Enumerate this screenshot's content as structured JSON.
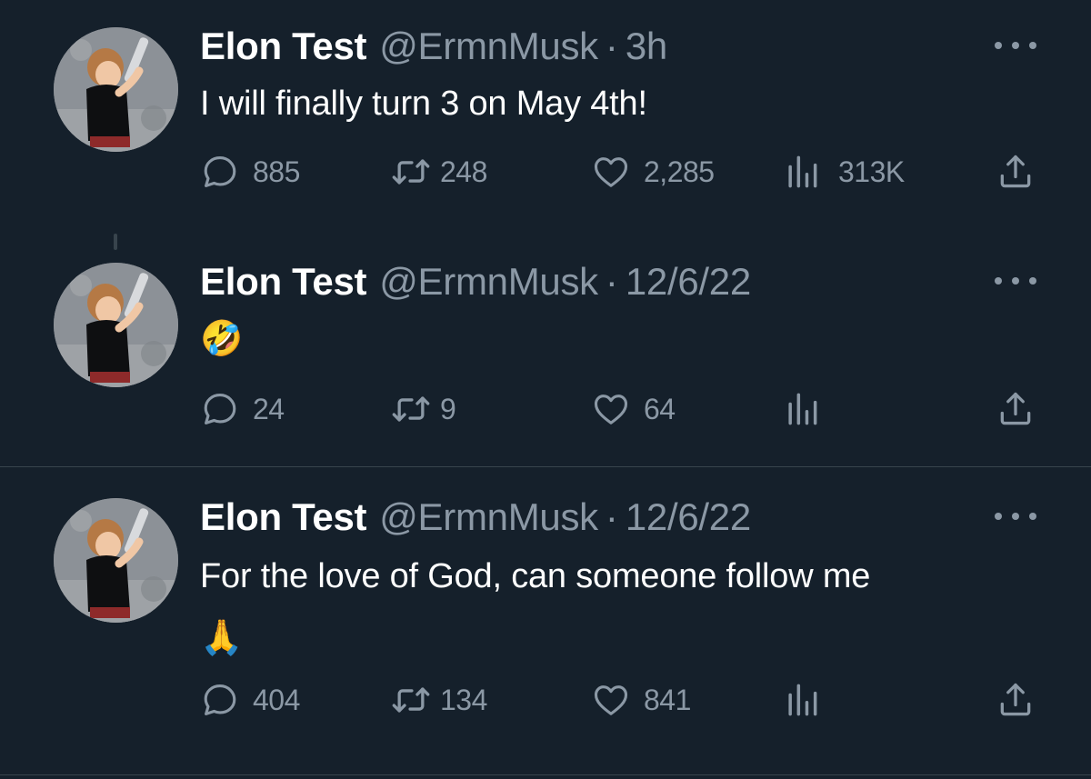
{
  "tweets": [
    {
      "author_name": "Elon Test",
      "handle": "@ErmnMusk",
      "separator": "·",
      "timestamp": "3h",
      "text": "I will finally turn 3 on May 4th!",
      "replies": "885",
      "retweets": "248",
      "likes": "2,285",
      "views": "313K"
    },
    {
      "author_name": "Elon Test",
      "handle": "@ErmnMusk",
      "separator": "·",
      "timestamp": "12/6/22",
      "text": "🤣",
      "replies": "24",
      "retweets": "9",
      "likes": "64",
      "views": ""
    },
    {
      "author_name": "Elon Test",
      "handle": "@ErmnMusk",
      "separator": "·",
      "timestamp": "12/6/22",
      "text": "For the love of God, can someone follow me",
      "text_line2": "🙏",
      "replies": "404",
      "retweets": "134",
      "likes": "841",
      "views": ""
    }
  ],
  "colors": {
    "background": "#15202b",
    "primary_text": "#ffffff",
    "secondary_text": "#8b98a5",
    "divider": "#38444d"
  },
  "icons": [
    "reply-icon",
    "retweet-icon",
    "like-icon",
    "views-icon",
    "share-icon",
    "more-icon"
  ]
}
